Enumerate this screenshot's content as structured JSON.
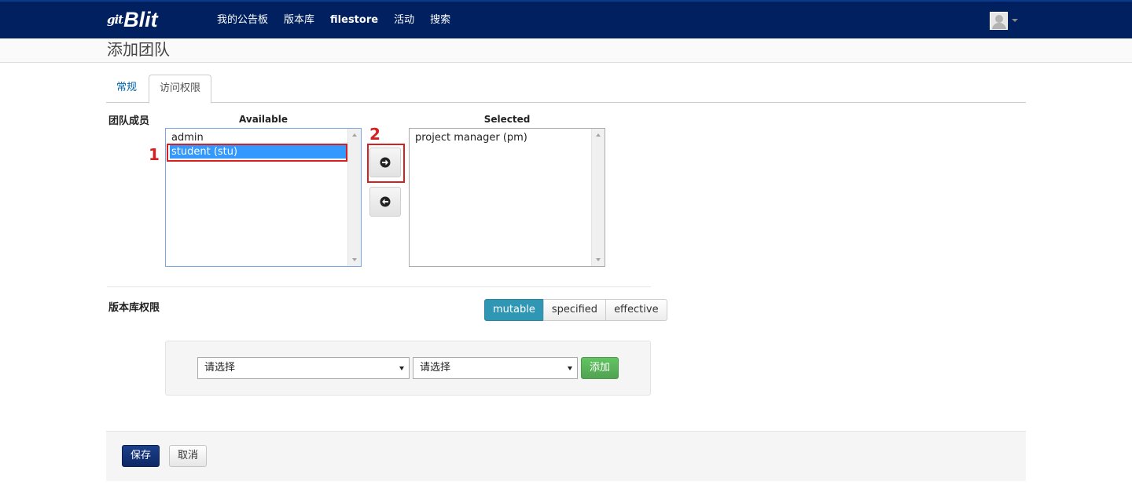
{
  "navbar": {
    "logo_prefix": "git",
    "logo_text": "Blit",
    "links": [
      "我的公告板",
      "版本库",
      "filestore",
      "活动",
      "搜索"
    ],
    "user_icon": "user-avatar-icon"
  },
  "page": {
    "title": "添加团队"
  },
  "tabs": [
    {
      "label": "常规",
      "active": false
    },
    {
      "label": "访问权限",
      "active": true
    }
  ],
  "members": {
    "section_label": "团队成员",
    "available_label": "Available",
    "selected_label": "Selected",
    "available": [
      "admin",
      "student (stu)"
    ],
    "available_selected_index": 1,
    "selected": [
      "project manager (pm)"
    ],
    "move_right_icon": "arrow-right-icon",
    "move_left_icon": "arrow-left-icon"
  },
  "annotations": [
    "1",
    "2"
  ],
  "permissions": {
    "section_label": "版本库权限",
    "modes": [
      "mutable",
      "specified",
      "effective"
    ],
    "active_mode": "mutable",
    "select1_value": "请选择",
    "select2_value": "请选择",
    "add_label": "添加"
  },
  "actions": {
    "save_label": "保存",
    "cancel_label": "取消"
  },
  "colors": {
    "navbar_bg": "#002060",
    "selection": "#3399ff",
    "active_mode": "#2f96b4",
    "add_button": "#5bb75b",
    "save_button": "#0d2766",
    "annotation_red": "#d42020"
  }
}
